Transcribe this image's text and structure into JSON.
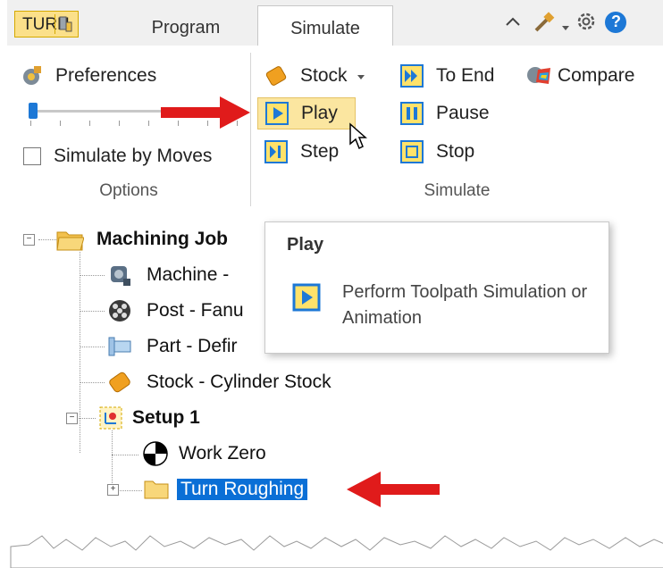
{
  "tabs": {
    "turn_label": "TURN",
    "program": "Program",
    "simulate": "Simulate"
  },
  "quick_access": {
    "icons": [
      "mode-icon",
      "tools-icon",
      "dropdown-icon",
      "gear-icon",
      "help-icon"
    ],
    "help_glyph": "?"
  },
  "ribbon": {
    "options": {
      "preferences": "Preferences",
      "simulate_by_moves": "Simulate by Moves",
      "group_label": "Options",
      "slider_value": 0.05,
      "simulate_by_moves_checked": false
    },
    "simulate": {
      "stock": "Stock",
      "play": "Play",
      "step": "Step",
      "to_end": "To End",
      "pause": "Pause",
      "stop": "Stop",
      "compare": "Compare",
      "group_label": "Simulate"
    }
  },
  "tooltip": {
    "title": "Play",
    "body": "Perform Toolpath Simulation or Animation"
  },
  "tree": {
    "machining_job": "Machining Job",
    "machine": "Machine - ",
    "post": "Post - Fanu",
    "part": "Part - Defir",
    "stock": "Stock - Cylinder Stock",
    "setup": "Setup 1",
    "work_zero": "Work Zero",
    "turn_roughing": "Turn Roughing"
  },
  "colors": {
    "accent_blue": "#1d78d6",
    "selection": "#0a6fd6",
    "highlight": "#fbe6a0",
    "arrow_red": "#e01b1b"
  }
}
